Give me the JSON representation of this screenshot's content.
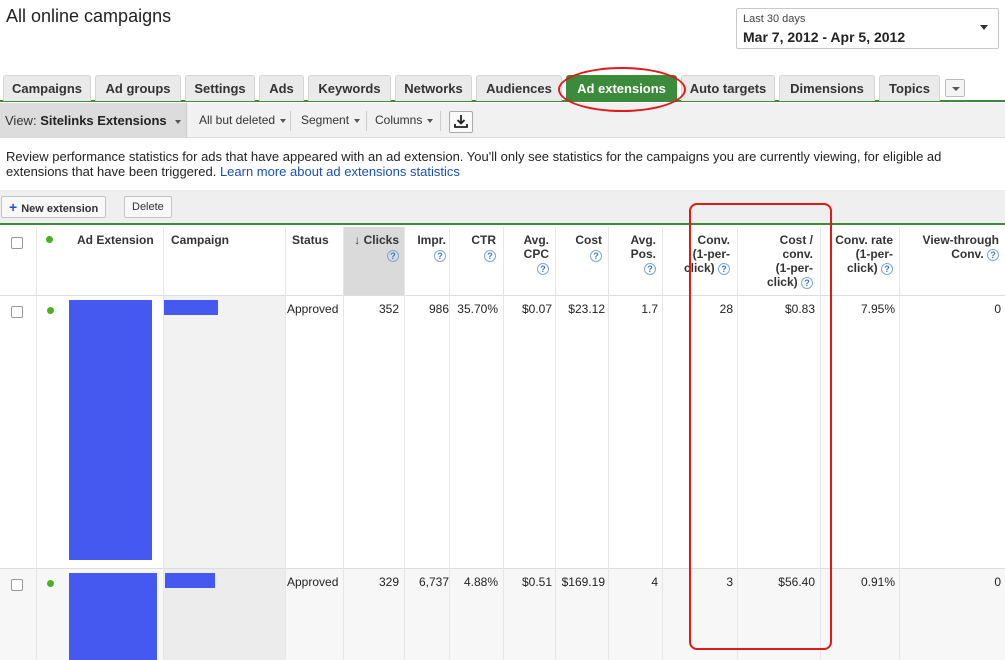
{
  "header": {
    "title": "All online campaigns",
    "date_range": {
      "label": "Last 30 days",
      "value": "Mar 7, 2012 - Apr 5, 2012"
    }
  },
  "tabs": [
    {
      "label": "Campaigns"
    },
    {
      "label": "Ad groups"
    },
    {
      "label": "Settings"
    },
    {
      "label": "Ads"
    },
    {
      "label": "Keywords"
    },
    {
      "label": "Networks"
    },
    {
      "label": "Audiences"
    },
    {
      "label": "Ad extensions"
    },
    {
      "label": "Auto targets"
    },
    {
      "label": "Dimensions"
    },
    {
      "label": "Topics"
    }
  ],
  "active_tab": "Ad extensions",
  "toolbar": {
    "view_prefix": "View:",
    "view_value": "Sitelinks Extensions",
    "filter": "All but deleted",
    "segment": "Segment",
    "columns": "Columns"
  },
  "description": {
    "text": "Review performance statistics for ads that have appeared with an ad extension. You'll only see statistics for the campaigns you are currently viewing, for eligible ad extensions that have been triggered.",
    "link": "Learn more about ad extensions statistics"
  },
  "actions": {
    "new_extension": "New extension",
    "delete": "Delete"
  },
  "table": {
    "headers": {
      "ad_extension": "Ad Extension",
      "campaign": "Campaign",
      "status": "Status",
      "clicks": "Clicks",
      "impr": "Impr.",
      "ctr": "CTR",
      "avg_cpc_1": "Avg.",
      "avg_cpc_2": "CPC",
      "cost": "Cost",
      "avg_pos_1": "Avg.",
      "avg_pos_2": "Pos.",
      "conv_1": "Conv.",
      "conv_2": "(1-per-",
      "conv_3": "click)",
      "cost_conv_1": "Cost /",
      "cost_conv_2": "conv.",
      "cost_conv_3": "(1-per-",
      "cost_conv_4": "click)",
      "conv_rate_1": "Conv. rate",
      "conv_rate_2": "(1-per-",
      "conv_rate_3": "click)",
      "view_through_1": "View-through",
      "view_through_2": "Conv."
    },
    "rows": [
      {
        "status": "Approved",
        "clicks": "352",
        "impr": "986",
        "ctr": "35.70%",
        "avg_cpc": "$0.07",
        "cost": "$23.12",
        "avg_pos": "1.7",
        "conv": "28",
        "cost_conv": "$0.83",
        "conv_rate": "7.95%",
        "view_through": "0"
      },
      {
        "status": "Approved",
        "clicks": "329",
        "impr": "6,737",
        "ctr": "4.88%",
        "avg_cpc": "$0.51",
        "cost": "$169.19",
        "avg_pos": "4",
        "conv": "3",
        "cost_conv": "$56.40",
        "conv_rate": "0.91%",
        "view_through": "0"
      }
    ]
  },
  "colors": {
    "accent_green": "#3c8b3c",
    "annotation_red": "#e01a1a",
    "redaction_blue": "#4558f0",
    "status_dot": "#4caf24",
    "link_blue": "#1a4fb8"
  },
  "icons": [
    "chevron-down-icon",
    "download-icon",
    "plus-icon",
    "help-icon",
    "sort-arrow-icon",
    "status-dot-icon"
  ]
}
